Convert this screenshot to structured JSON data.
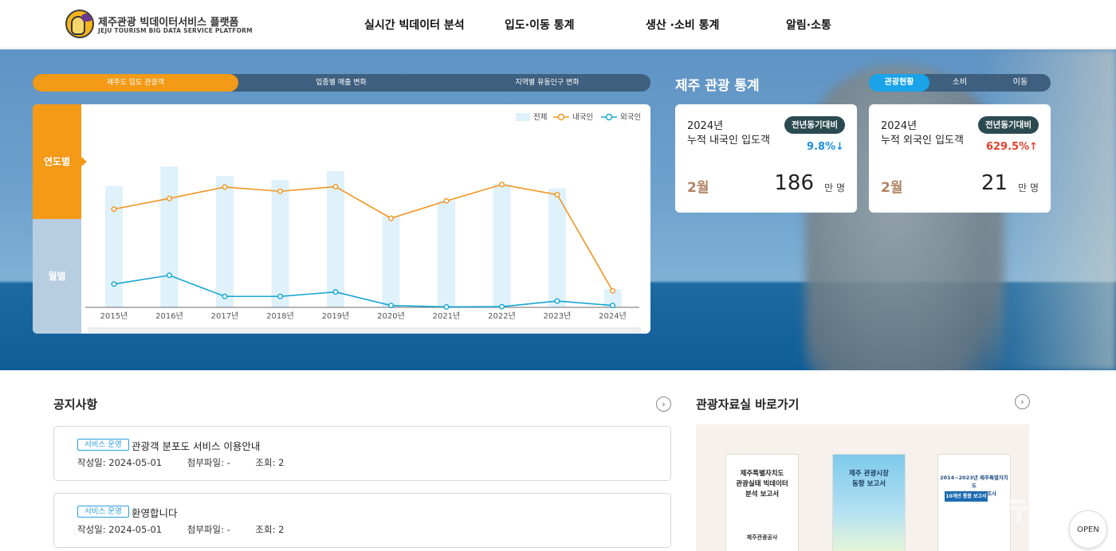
{
  "header": {
    "brand_name": "제주관광 빅데이터서비스 플랫폼",
    "brand_sub": "JEJU TOURISM BIG DATA SERVICE PLATFORM",
    "nav": [
      "실시간 빅데이터 분석",
      "입도·이동 통계",
      "생산 ·소비 통계",
      "알림·소통"
    ]
  },
  "chart_tabs": [
    "제주도 입도 관광객",
    "업종별 매출 변화",
    "지역별 유동인구 변화"
  ],
  "chart_side": [
    "연도별",
    "월별"
  ],
  "chart_data": {
    "type": "bar",
    "categories": [
      "2015년",
      "2016년",
      "2017년",
      "2018년",
      "2019년",
      "2020년",
      "2021년",
      "2022년",
      "2023년",
      "2024년"
    ],
    "series": [
      {
        "name": "전체",
        "type": "bar",
        "values": [
          1366,
          1585,
          1475,
          1431,
          1529,
          1024,
          1200,
          1388,
          1337,
          207
        ]
      },
      {
        "name": "내국인",
        "type": "line",
        "values": [
          1104,
          1224,
          1352,
          1304,
          1356,
          1001,
          1196,
          1380,
          1266,
          186
        ]
      },
      {
        "name": "외국인",
        "type": "line",
        "values": [
          262,
          360,
          123,
          123,
          173,
          21,
          5,
          8,
          71,
          21
        ]
      }
    ],
    "colors": {
      "total": "#dff1fb",
      "domestic": "#f0951e",
      "foreign": "#16a6d2"
    },
    "ylim": [
      0,
      1700
    ],
    "legend": "top-right"
  },
  "stats": {
    "title": "제주 관광 통계",
    "tabs": [
      "관광현황",
      "소비",
      "이동"
    ],
    "cards": [
      {
        "year": "2024년",
        "label": "누적 내국인 입도객",
        "badge": "전년동기대비",
        "change": "9.8%↓",
        "change_color": "#1e8fe0",
        "month": "2월",
        "value": "186",
        "unit": "만 명"
      },
      {
        "year": "2024년",
        "label": "누적 외국인 입도객",
        "badge": "전년동기대비",
        "change": "629.5%↑",
        "change_color": "#e8402c",
        "month": "2월",
        "value": "21",
        "unit": "만 명"
      }
    ]
  },
  "notice": {
    "title": "공지사항",
    "items": [
      {
        "tag": "서비스 운영",
        "title": "관광객 분포도 서비스 이용안내",
        "date": "작성일: 2024-05-01",
        "file": "첨부파일: -",
        "views": "조회: 2"
      },
      {
        "tag": "서비스 운영",
        "title": "환영합니다",
        "date": "작성일: 2024-05-01",
        "file": "첨부파일: -",
        "views": "조회: 2"
      }
    ]
  },
  "reference": {
    "title": "관광자료실 바로가기",
    "books": [
      {
        "title": "제주특별자치도\n관광실태 빅데이터\n분석 보고서",
        "publisher": "제주관광공사"
      },
      {
        "title": "제주 관광시장\n동향 보고서"
      },
      {
        "title": "2014~2023년 제주특별자치도\n방문관광객 실태조사",
        "subtitle": "10개년 통합 보고서"
      }
    ]
  },
  "watermark": "뉴스1",
  "open_button": "OPEN"
}
